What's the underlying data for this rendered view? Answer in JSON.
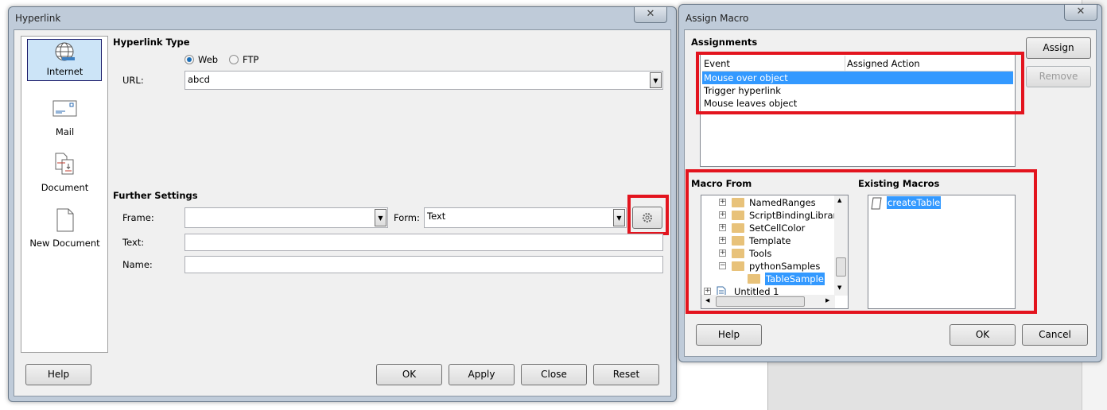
{
  "hyperlink": {
    "title": "Hyperlink",
    "close": "✕",
    "nav": [
      {
        "label": "Internet",
        "icon": "globe-icon",
        "selected": true
      },
      {
        "label": "Mail",
        "icon": "envelope-icon"
      },
      {
        "label": "Document",
        "icon": "document-icon"
      },
      {
        "label": "New Document",
        "icon": "new-document-icon"
      }
    ],
    "type_heading": "Hyperlink Type",
    "radios": [
      {
        "label": "Web",
        "checked": true
      },
      {
        "label": "FTP",
        "checked": false
      }
    ],
    "url_label": "URL:",
    "url_value": "abcd",
    "further_heading": "Further Settings",
    "frame_label": "Frame:",
    "frame_value": "",
    "form_label": "Form:",
    "form_value": "Text",
    "text_label": "Text:",
    "text_value": "",
    "name_label": "Name:",
    "name_value": "",
    "buttons": {
      "help": "Help",
      "ok": "OK",
      "apply": "Apply",
      "close": "Close",
      "reset": "Reset"
    }
  },
  "assign_macro": {
    "title": "Assign Macro",
    "close": "✕",
    "assignments_heading": "Assignments",
    "columns": [
      "Event",
      "Assigned Action"
    ],
    "events": [
      {
        "event": "Mouse over object",
        "action": "",
        "selected": true
      },
      {
        "event": "Trigger hyperlink",
        "action": ""
      },
      {
        "event": "Mouse leaves object",
        "action": ""
      }
    ],
    "assign": "Assign",
    "remove": "Remove",
    "macro_from_heading": "Macro From",
    "tree": [
      {
        "label": "NamedRanges",
        "expand": "+"
      },
      {
        "label": "ScriptBindingLibrary",
        "expand": "+"
      },
      {
        "label": "SetCellColor",
        "expand": "+"
      },
      {
        "label": "Template",
        "expand": "+"
      },
      {
        "label": "Tools",
        "expand": "+"
      },
      {
        "label": "pythonSamples",
        "expand": "−"
      },
      {
        "label": "TableSample",
        "selected": true
      },
      {
        "label": "Untitled 1",
        "expand": "+"
      }
    ],
    "existing_heading": "Existing Macros",
    "macros": [
      {
        "label": "createTable",
        "selected": true
      }
    ],
    "buttons": {
      "help": "Help",
      "ok": "OK",
      "cancel": "Cancel"
    }
  },
  "colors": {
    "highlight": "#3399ff",
    "annotation": "#e3141e"
  }
}
